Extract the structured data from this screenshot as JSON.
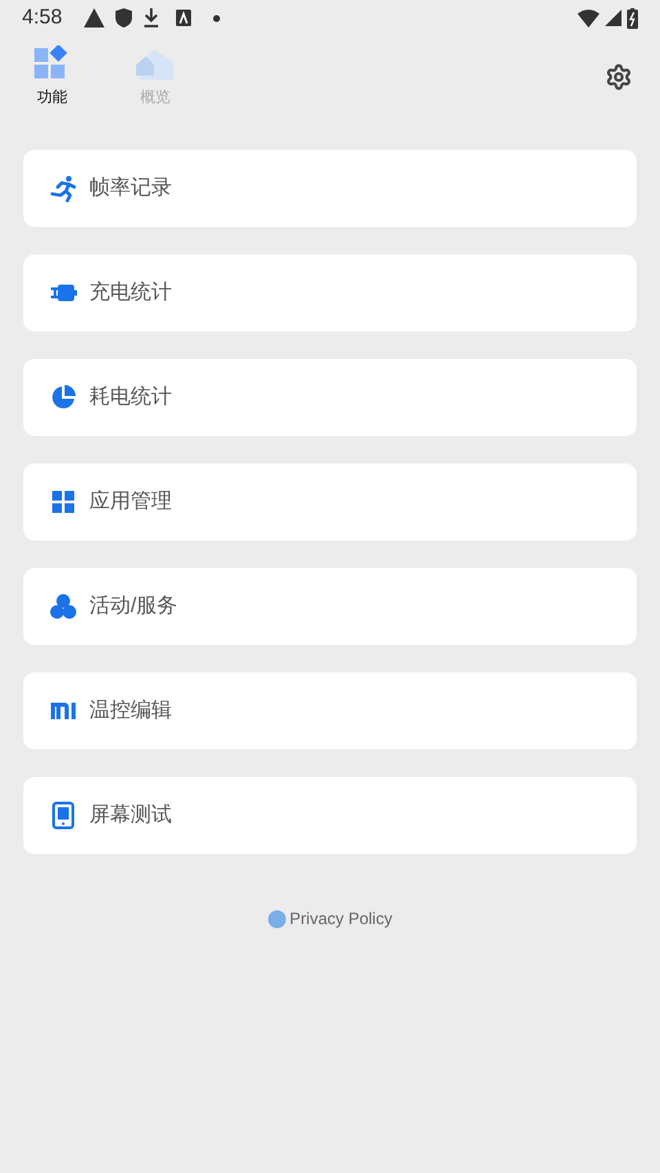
{
  "status_bar": {
    "time": "4:58"
  },
  "tabs": [
    {
      "label": "功能",
      "kind": "features",
      "selected": true
    },
    {
      "label": "概览",
      "kind": "overview",
      "selected": false
    }
  ],
  "items": [
    {
      "label": "帧率记录",
      "kind": "run"
    },
    {
      "label": "充电统计",
      "kind": "charge"
    },
    {
      "label": "耗电统计",
      "kind": "pie"
    },
    {
      "label": "应用管理",
      "kind": "apps"
    },
    {
      "label": "活动/服务",
      "kind": "circles"
    },
    {
      "label": "温控编辑",
      "kind": "mi"
    },
    {
      "label": "屏幕测试",
      "kind": "screen"
    }
  ],
  "footer": {
    "link": "Privacy Policy"
  }
}
